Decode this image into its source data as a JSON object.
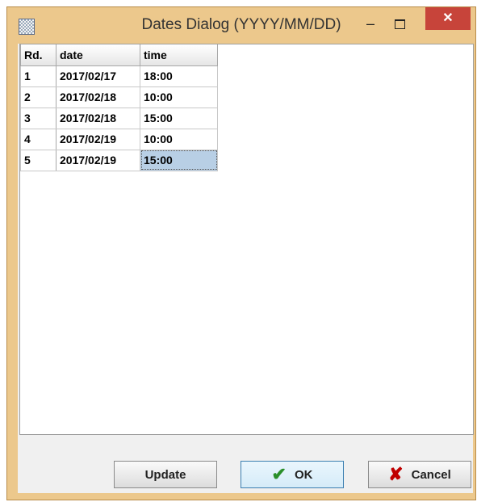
{
  "window": {
    "title": "Dates Dialog (YYYY/MM/DD)",
    "minimize_label": "–",
    "close_label": "✕",
    "icon": "app-icon"
  },
  "table": {
    "headers": [
      "Rd.",
      "date",
      "time"
    ],
    "rows": [
      {
        "rd": "1",
        "date": "2017/02/17",
        "time": "18:00"
      },
      {
        "rd": "2",
        "date": "2017/02/18",
        "time": "10:00"
      },
      {
        "rd": "3",
        "date": "2017/02/18",
        "time": "15:00"
      },
      {
        "rd": "4",
        "date": "2017/02/19",
        "time": "10:00"
      },
      {
        "rd": "5",
        "date": "2017/02/19",
        "time": "15:00"
      }
    ]
  },
  "buttons": {
    "update_label": "Update",
    "ok_label": "OK",
    "ok_icon": "checkmark-icon",
    "cancel_label": "Cancel",
    "cancel_icon": "x-icon"
  },
  "colors": {
    "window_frame": "#ecc88c",
    "close_button": "#c7443a",
    "selected_cell": "#b8cfe5",
    "ok_icon": "#2a8f2a",
    "cancel_icon": "#c00000"
  }
}
